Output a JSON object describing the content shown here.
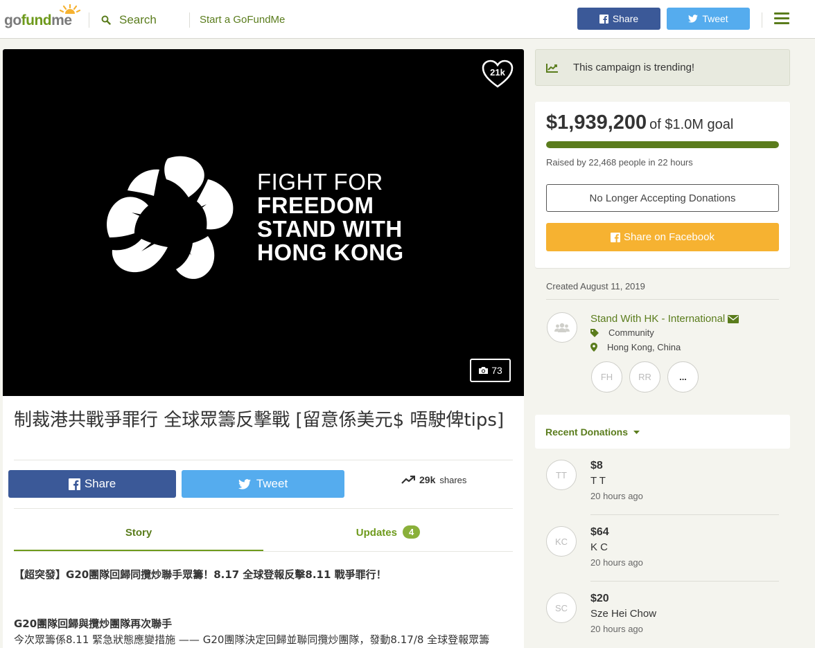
{
  "header": {
    "logo": {
      "go": "go",
      "fund": "fund",
      "me": "me"
    },
    "search_label": "Search",
    "start_link": "Start a GoFundMe",
    "share_label": "Share",
    "tweet_label": "Tweet"
  },
  "hero": {
    "heart_count": "21k",
    "text_lines": [
      "FIGHT FOR",
      "FREEDOM",
      "STAND WITH",
      "HONG KONG"
    ],
    "photo_count": "73"
  },
  "campaign": {
    "title": "制裁港共戰爭罪行 全球眾籌反擊戰 [留意係美元$ 唔駛俾tips]"
  },
  "social": {
    "share_label": "Share",
    "tweet_label": "Tweet",
    "shares_value": "29k",
    "shares_word": "shares"
  },
  "tabs": {
    "story": "Story",
    "updates": "Updates",
    "updates_count": "4"
  },
  "story": {
    "line1": "【超突發】G20團隊回歸同攬炒聯手眾籌！8.17 全球登報反擊8.11 戰爭罪行！",
    "heading": "G20團隊回歸與攬炒團隊再次聯手",
    "para": "今次眾籌係8.11 緊急狀態應變措施 —— G20團隊決定回歸並聯同攬炒團隊，發動8.17/8 全球登報眾籌"
  },
  "sidebar": {
    "trending": "This campaign is trending!",
    "raised_amount": "$1,939,200",
    "goal_text": "of $1.0M goal",
    "progress_fraction": 1.0,
    "raised_by": "Raised by 22,468 people in 22 hours",
    "no_longer": "No Longer Accepting Donations",
    "share_facebook": "Share on Facebook",
    "created": "Created August 11, 2019",
    "organizer": {
      "name": "Stand With HK - International",
      "category": "Community",
      "location": "Hong Kong, China"
    },
    "team": [
      "FH",
      "RR",
      "..."
    ],
    "recent_donations_label": "Recent Donations",
    "donations": [
      {
        "initials": "TT",
        "amount": "$8",
        "name": "T T",
        "time": "20 hours ago"
      },
      {
        "initials": "KC",
        "amount": "$64",
        "name": "K C",
        "time": "20 hours ago"
      },
      {
        "initials": "SC",
        "amount": "$20",
        "name": "Sze Hei Chow",
        "time": "20 hours ago"
      }
    ]
  },
  "colors": {
    "brand_green": "#5a7c1c",
    "facebook_blue": "#3b5998",
    "twitter_blue": "#55acee",
    "share_orange": "#f6b231"
  }
}
